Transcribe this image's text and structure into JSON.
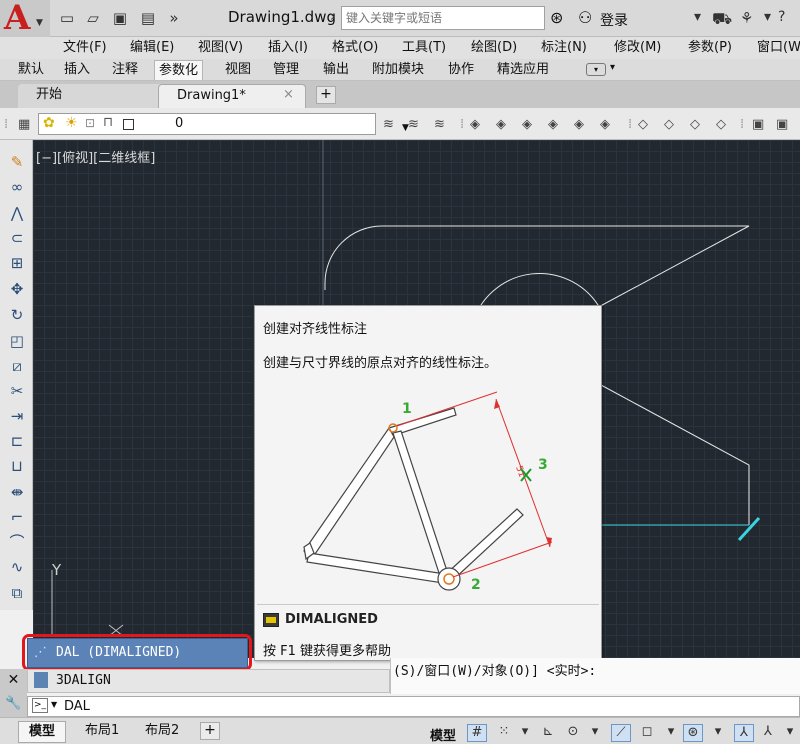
{
  "titlebar": {
    "app_logo": "A",
    "doc_title": "Drawing1.dwg",
    "search_placeholder": "键入关键字或短语",
    "login": "登录",
    "overflow": "»"
  },
  "menu": [
    "文件(F)",
    "编辑(E)",
    "视图(V)",
    "插入(I)",
    "格式(O)",
    "工具(T)",
    "绘图(D)",
    "标注(N)",
    "修改(M)",
    "参数(P)",
    "窗口(W"
  ],
  "ribbon_tabs": [
    "默认",
    "插入",
    "注释",
    "参数化",
    "视图",
    "管理",
    "输出",
    "附加模块",
    "协作",
    "精选应用"
  ],
  "ribbon_active": "参数化",
  "file_tabs": {
    "start": "开始",
    "drawing": "Drawing1*",
    "close": "×",
    "add": "+"
  },
  "layer": {
    "name": "0"
  },
  "viewport_label": "[−][俯视][二维线框]",
  "ucs": {
    "y": "Y",
    "x": "X"
  },
  "tooltip": {
    "title": "创建对齐线性标注",
    "description": "创建与尺寸界线的原点对齐的线性标注。",
    "point_labels": [
      "1",
      "2",
      "3"
    ],
    "command": "DIMALIGNED",
    "help": "按 F1 键获得更多帮助",
    "colors": {
      "dimension": "#e03030",
      "labels": "#3aaa35",
      "marker": "#1f9a2a",
      "frame_fill": "#ffffff",
      "frame_stroke": "#444444"
    }
  },
  "autocomplete": {
    "highlighted": "DAL (DIMALIGNED)",
    "other": "3DALIGN",
    "highlight_color": "#e1171c",
    "selected_color": "#5b83b7"
  },
  "command_history": "(S)/窗口(W)/对象(O)] <实时>:",
  "command_line": {
    "input": "DAL"
  },
  "statusbar": {
    "model_tab": "模型",
    "layout1": "布局1",
    "layout2": "布局2",
    "add": "+",
    "model_label": "模型"
  },
  "canvas_colors": {
    "background": "#212830",
    "geometry": "#e6e6e6",
    "dimension": "#3ad3df"
  }
}
